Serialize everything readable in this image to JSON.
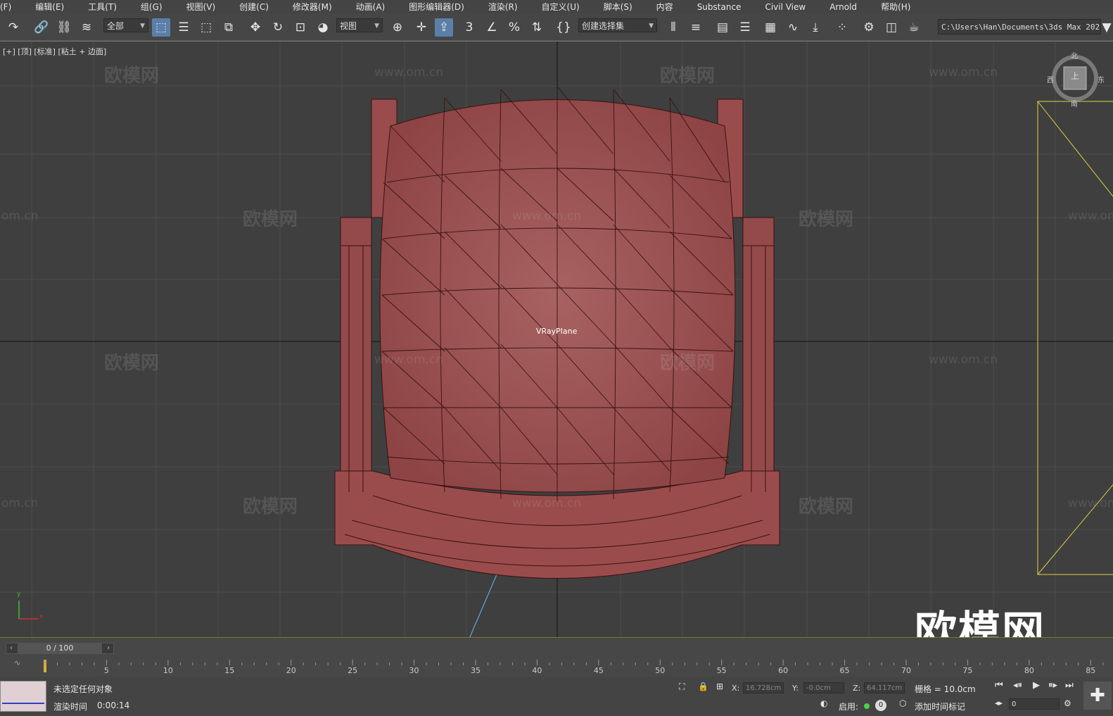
{
  "menu": [
    "(F)",
    "编辑(E)",
    "工具(T)",
    "组(G)",
    "视图(V)",
    "创建(C)",
    "修改器(M)",
    "动画(A)",
    "图形编辑器(D)",
    "渲染(R)",
    "自定义(U)",
    "脚本(S)",
    "内容",
    "Substance",
    "Civil View",
    "Arnold",
    "帮助(H)"
  ],
  "toolbar": {
    "selection_filter": "全部",
    "ref_coord": "视图",
    "named_selection": "创建选择集",
    "project_path": "C:\\Users\\Han\\Documents\\3ds Max 2022"
  },
  "viewport": {
    "label": "[+] [顶] [标准] [粘土 + 边面]",
    "object_label": "VRayPlane",
    "viewcube": {
      "face": "上",
      "north": "北",
      "south": "南",
      "east": "东",
      "west": "西"
    },
    "watermark_brand": "欧模网",
    "watermark_url": "www.om.cn",
    "watermark_url_short": "om.cn",
    "axis_label_y": "y",
    "axis_label_x": "x"
  },
  "timeline": {
    "frame_display": "0 / 100",
    "ticks": [
      "5",
      "10",
      "15",
      "20",
      "25",
      "30",
      "35",
      "40",
      "45",
      "50",
      "55",
      "60",
      "65",
      "70",
      "75",
      "80",
      "85"
    ]
  },
  "status": {
    "selection": "未选定任何对象",
    "render_time_label": "渲染时间",
    "render_time": "0:00:14",
    "x_label": "X:",
    "x_value": "16.728cm",
    "y_label": "Y:",
    "y_value": "-0.0cm",
    "z_label": "Z:",
    "z_value": "64.117cm",
    "grid": "栅格 = 10.0cm",
    "enable_label": "启用:",
    "counter": "0",
    "add_time_tag": "添加时间标记",
    "frame_field": "0"
  },
  "colors": {
    "mesh_fill": "#9a4c4c",
    "mesh_wire": "#3a1010",
    "viewport_bg": "#3f3f3f",
    "grid": "#4d4d4d"
  }
}
